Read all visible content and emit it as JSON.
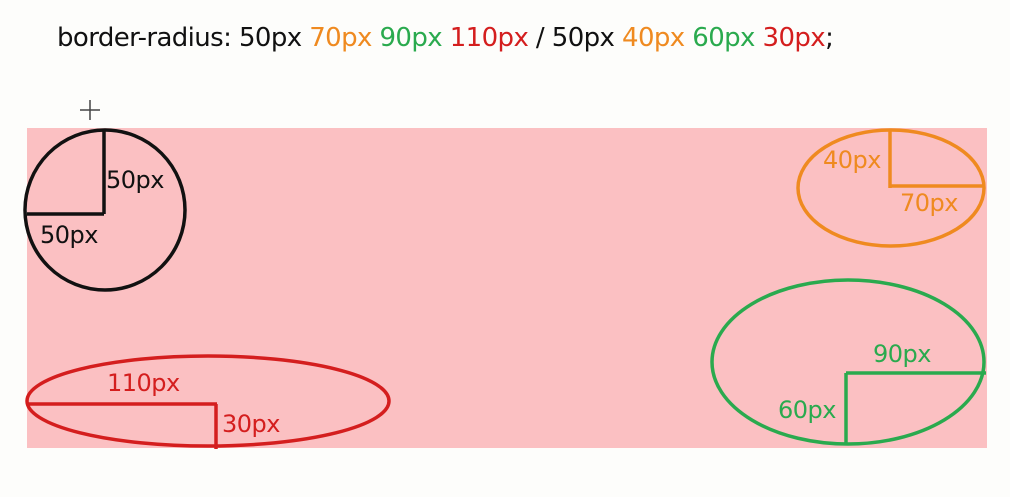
{
  "code": {
    "property": "border-radius:",
    "v1": "50px",
    "v2": "70px",
    "v3": "90px",
    "v4": "110px",
    "slash": "/",
    "v5": "50px",
    "v6": "40px",
    "v7": "60px",
    "v8": "30px",
    "semicolon": ";"
  },
  "corners": {
    "top_left": {
      "horizontal_label": "50px",
      "vertical_label": "50px"
    },
    "top_right": {
      "horizontal_label": "70px",
      "vertical_label": "40px"
    },
    "bottom_right": {
      "horizontal_label": "90px",
      "vertical_label": "60px"
    },
    "bottom_left": {
      "horizontal_label": "110px",
      "vertical_label": "30px"
    }
  },
  "colors": {
    "background": "#fdfdfb",
    "box_fill": "#fbc0c2",
    "text": "#111111",
    "top_left": "#111111",
    "top_right": "#ef8a20",
    "bottom_right": "#2aaa4e",
    "bottom_left": "#d41e1e"
  },
  "icons": {
    "cursor": "crosshair-cursor-icon"
  }
}
